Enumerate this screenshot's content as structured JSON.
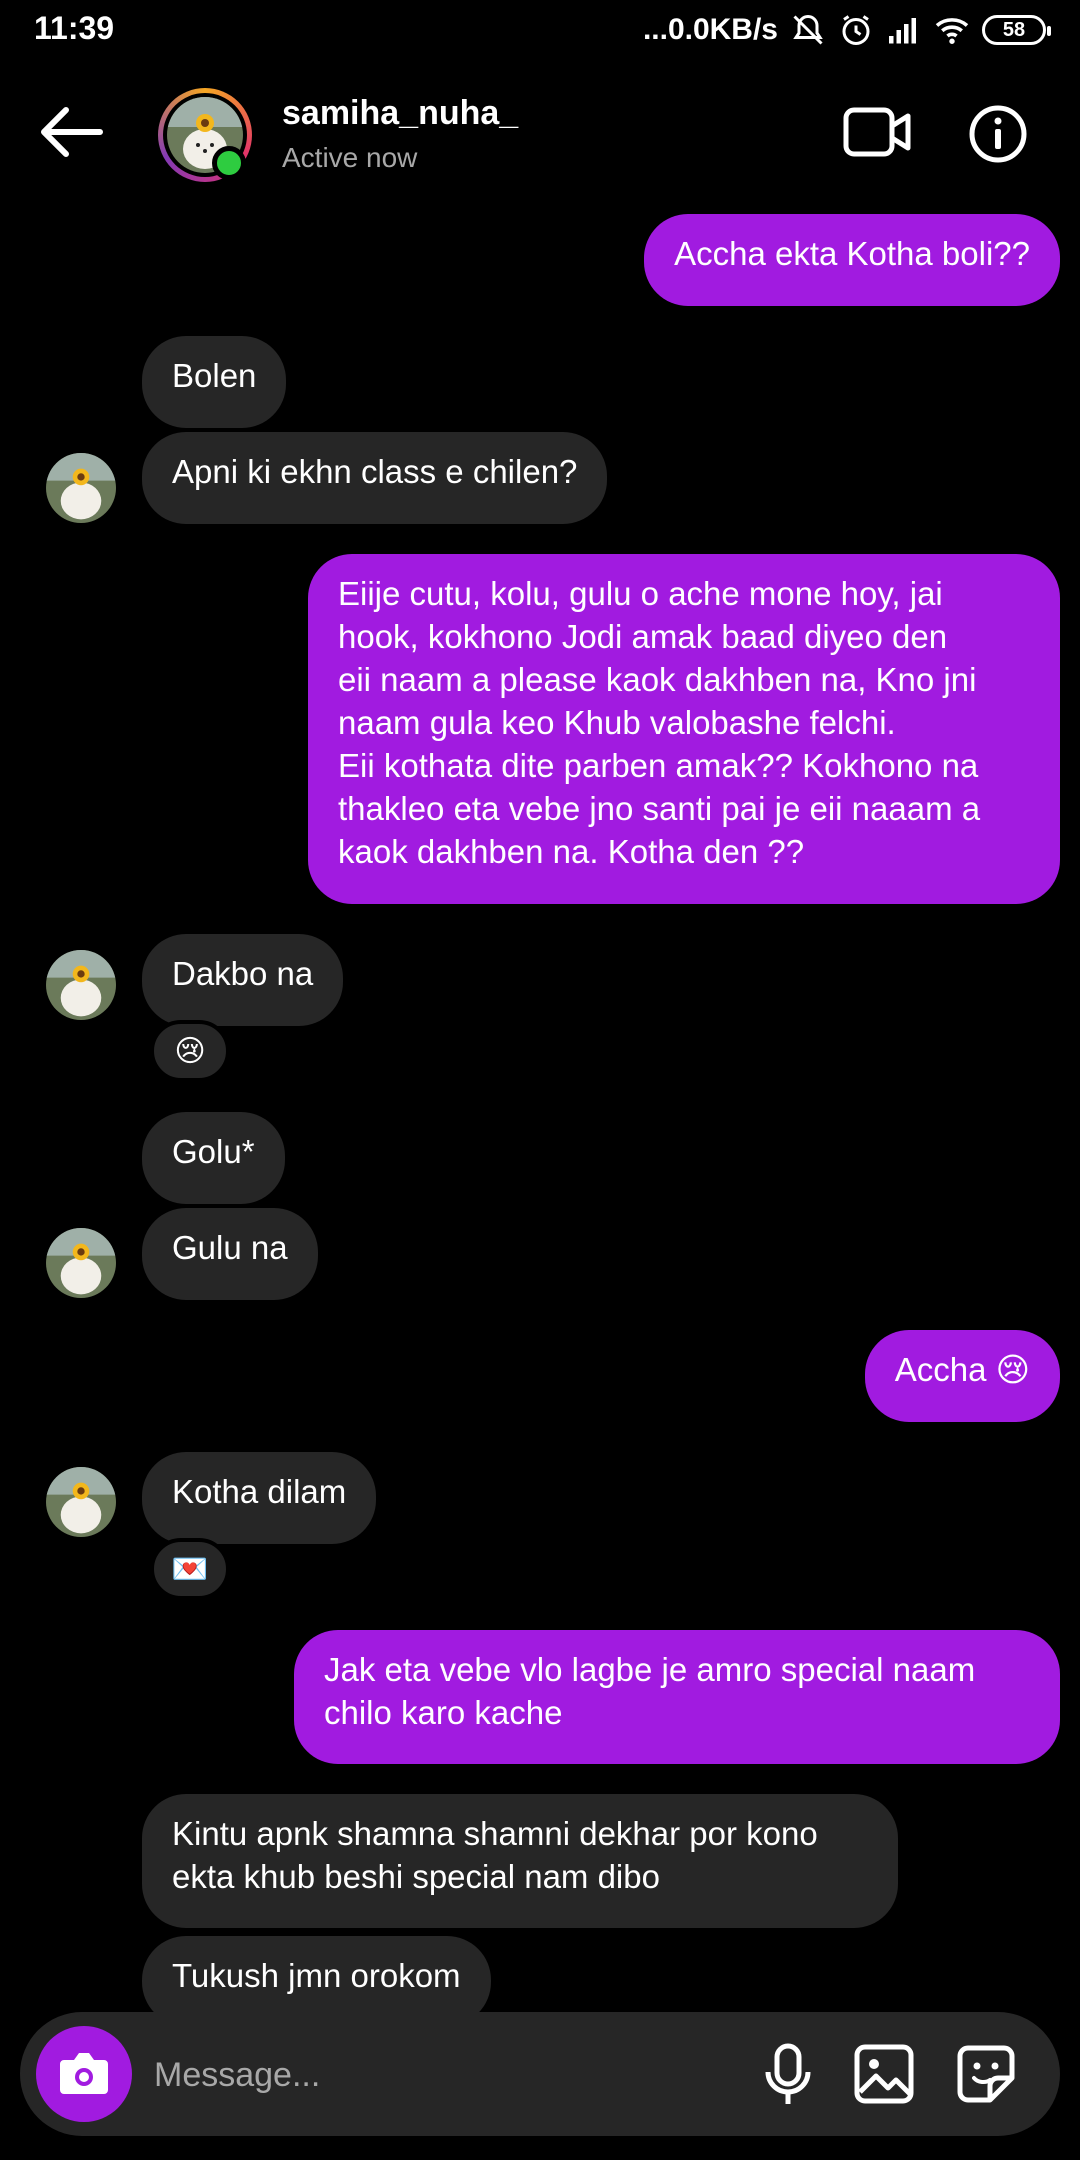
{
  "status_bar": {
    "time": "11:39",
    "network_speed": "...0.0KB/s",
    "battery": "58"
  },
  "header": {
    "username": "samiha_nuha_",
    "status": "Active now"
  },
  "messages": [
    {
      "id": 0,
      "dir": "out",
      "text": "Accha ekta Kotha boli??"
    },
    {
      "id": 1,
      "dir": "in",
      "text": "Bolen"
    },
    {
      "id": 2,
      "dir": "in",
      "text": "Apni ki ekhn class e chilen?"
    },
    {
      "id": 3,
      "dir": "out",
      "text": "Eiije cutu, kolu, gulu o ache mone hoy, jai\nhook, kokhono Jodi amak baad diyeo den\neii naam a please kaok dakhben na, Kno jni\nnaam gula keo Khub valobashe felchi.\nEii kothata dite parben amak?? Kokhono na\nthakleo eta vebe jno santi pai je eii naaam a\nkaok dakhben na. Kotha den ??"
    },
    {
      "id": 4,
      "dir": "in",
      "text": "Dakbo na",
      "reaction": "😢"
    },
    {
      "id": 5,
      "dir": "in",
      "text": "Golu*"
    },
    {
      "id": 6,
      "dir": "in",
      "text": "Gulu na"
    },
    {
      "id": 7,
      "dir": "out",
      "text": "Accha 😢"
    },
    {
      "id": 8,
      "dir": "in",
      "text": "Kotha dilam",
      "reaction": "💌"
    },
    {
      "id": 9,
      "dir": "out",
      "text": "Jak eta vebe vlo lagbe je amro special naam\nchilo karo kache"
    },
    {
      "id": 10,
      "dir": "in",
      "text": "Kintu apnk shamna shamni dekhar por kono\nekta khub beshi special nam dibo"
    },
    {
      "id": 11,
      "dir": "in",
      "text": "Tukush jmn orokom"
    }
  ],
  "composer": {
    "placeholder": "Message..."
  },
  "colors": {
    "accent": "#a11be0",
    "incoming_bubble": "#262626",
    "online": "#2ecc40"
  },
  "icons": [
    "back-arrow-icon",
    "video-call-icon",
    "info-icon",
    "camera-icon",
    "microphone-icon",
    "gallery-icon",
    "sticker-icon"
  ]
}
